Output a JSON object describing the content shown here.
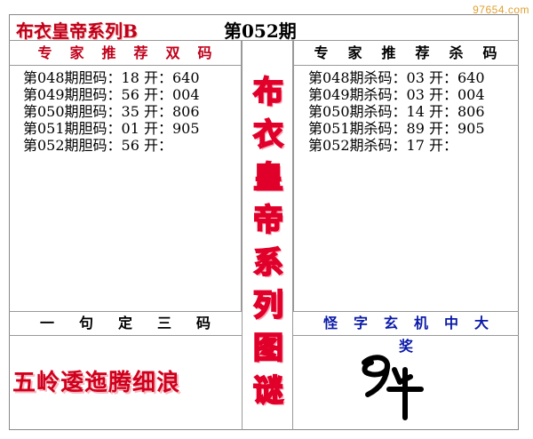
{
  "watermark": "97654.com",
  "header": {
    "title": "布衣皇帝系列B",
    "issue": "第052期"
  },
  "left_panel": {
    "heading": "专家推荐双码",
    "rows": [
      "第048期胆码：18 开：640",
      "第049期胆码：56 开：004",
      "第050期胆码：35 开：806",
      "第051期胆码：01 开：905",
      "第052期胆码：56 开："
    ]
  },
  "right_panel": {
    "heading": "专家推荐杀码",
    "rows": [
      "第048期杀码：03 开：640",
      "第049期杀码：03 开：004",
      "第050期杀码：14 开：806",
      "第051期杀码：89 开：905",
      "第052期杀码：17 开："
    ]
  },
  "center_vertical": [
    "布",
    "衣",
    "皇",
    "帝",
    "系",
    "列",
    "图",
    "谜"
  ],
  "bottom_left": {
    "heading": "一句定三码",
    "riddle": "五岭逶迤腾细浪"
  },
  "bottom_right": {
    "heading": "怪字玄机中大奖",
    "glyph_note": "handwritten-glyph"
  },
  "colors": {
    "red": "#c0001a",
    "blue": "#0a1aa8",
    "border": "#999999"
  }
}
